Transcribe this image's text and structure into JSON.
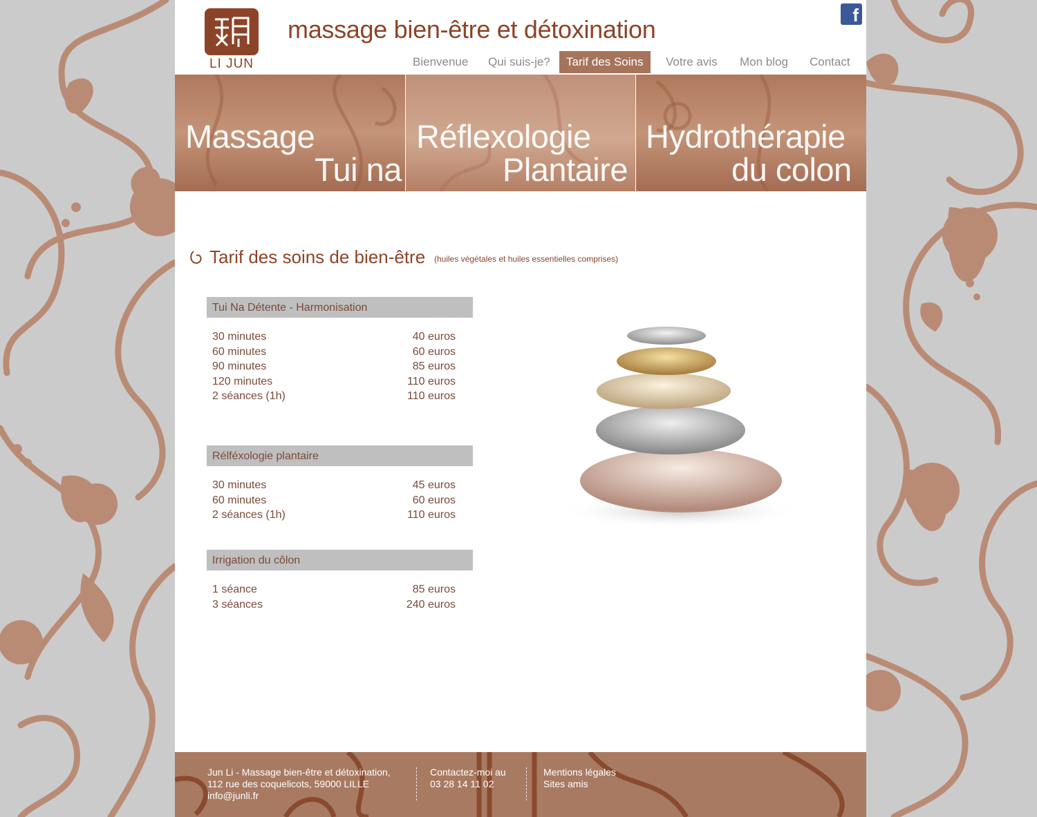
{
  "header": {
    "logo_text": "LI JUN",
    "site_title": "massage bien-être et détoxination",
    "facebook_glyph": "f"
  },
  "nav": {
    "items": [
      {
        "label": "Bienvenue"
      },
      {
        "label": "Qui suis-je?"
      },
      {
        "label": "Tarif des Soins",
        "active": true
      },
      {
        "label": "Votre avis"
      },
      {
        "label": "Mon blog"
      },
      {
        "label": "Contact"
      }
    ]
  },
  "banner": {
    "panels": [
      {
        "line1": "Massage",
        "line2": "Tui na"
      },
      {
        "line1": "Réflexologie",
        "line2": "Plantaire"
      },
      {
        "line1": "Hydrothérapie",
        "line2": "du colon"
      }
    ]
  },
  "main": {
    "title": "Tarif des soins de bien-être",
    "subtitle": "(huiles végétales et huiles essentielles comprises)",
    "sections": [
      {
        "heading": "Tui Na Détente - Harmonisation",
        "rows": [
          {
            "duration": "30 minutes",
            "price": "40 euros"
          },
          {
            "duration": "60 minutes",
            "price": "60 euros"
          },
          {
            "duration": "90 minutes",
            "price": "85 euros"
          },
          {
            "duration": "120 minutes",
            "price": "110 euros"
          },
          {
            "duration": "2 séances (1h)",
            "price": "110 euros"
          }
        ]
      },
      {
        "heading": "Rélféxologie plantaire",
        "rows": [
          {
            "duration": "30 minutes",
            "price": "45 euros"
          },
          {
            "duration": "60 minutes",
            "price": "60 euros"
          },
          {
            "duration": "2 séances (1h)",
            "price": "110 euros"
          }
        ]
      },
      {
        "heading": "Irrigation du côlon",
        "rows": [
          {
            "duration": "1 séance",
            "price": "85 euros"
          },
          {
            "duration": "3 séances",
            "price": "240 euros"
          }
        ]
      }
    ]
  },
  "footer": {
    "address_lines": [
      "Jun Li - Massage bien-être et détoxination,",
      "112 rue des coquelicots, 59000 LILLE",
      "info@junli.fr"
    ],
    "contact_lines": [
      "Contactez-moi au",
      "03 28 14 11 02"
    ],
    "links": [
      "Mentions légales",
      "Sites amis"
    ]
  },
  "colors": {
    "accent": "#8c4428",
    "nav_active": "#a5745a",
    "banner": "#b8826a",
    "background": "#cbcbcb",
    "table_header": "#bfbfbf",
    "text": "#7a4a38"
  },
  "icons": [
    "facebook-icon",
    "spiral-icon",
    "logo-seal-icon",
    "stones-image"
  ]
}
